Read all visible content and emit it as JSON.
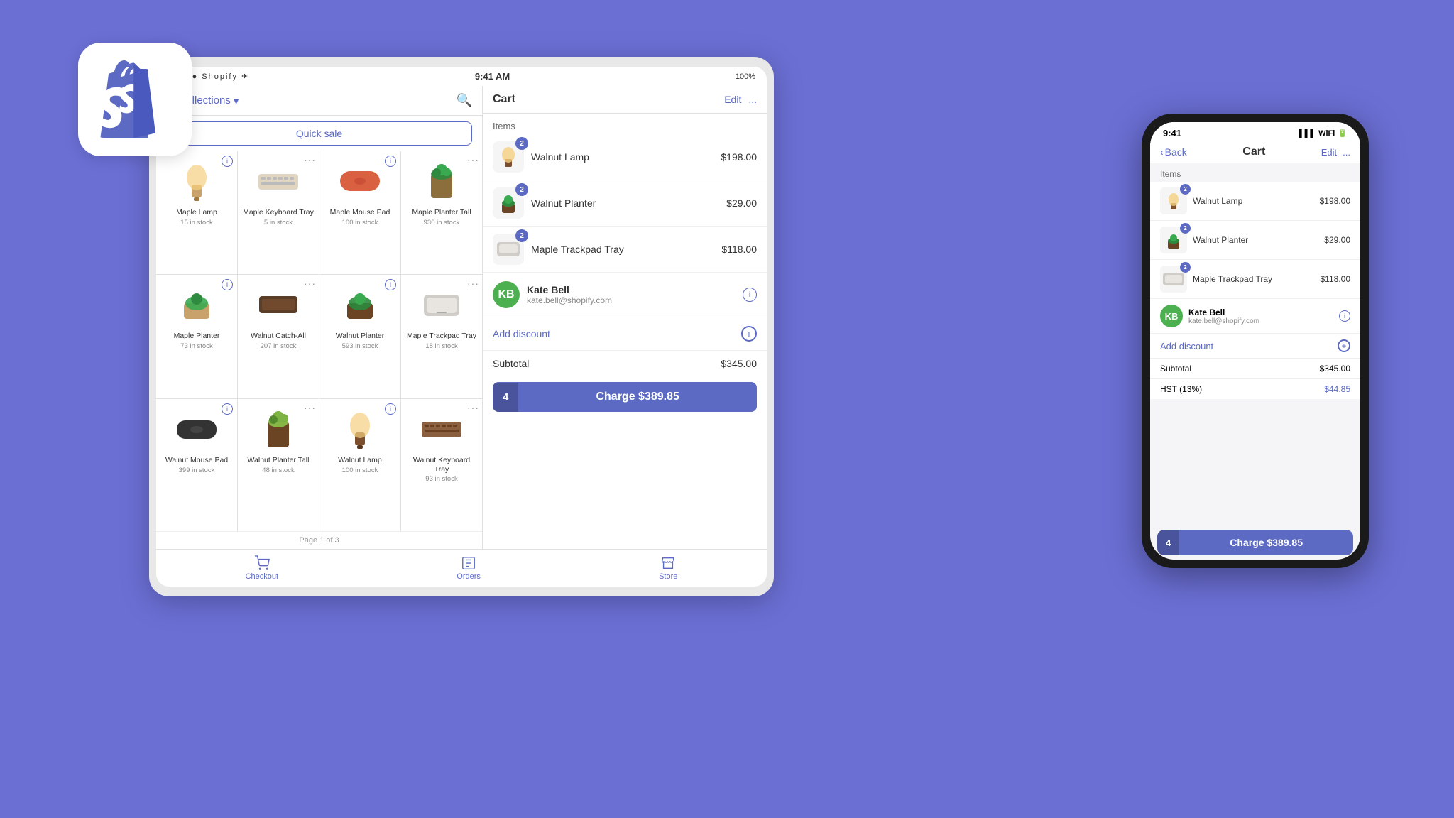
{
  "shopify_logo": {
    "alt": "Shopify Logo"
  },
  "tablet": {
    "status": {
      "signal": "•••••",
      "carrier": "Shopify",
      "wifi": "WiFi",
      "time": "9:41 AM",
      "battery": "100%"
    },
    "products_panel": {
      "collections_label": "All collections",
      "quick_sale_label": "Quick sale",
      "page_indicator": "Page 1 of 3",
      "products": [
        {
          "name": "Maple Lamp",
          "stock": "15 in stock",
          "type": "lamp"
        },
        {
          "name": "Maple Keyboard Tray",
          "stock": "5 in stock",
          "type": "keyboard"
        },
        {
          "name": "Maple Mouse Pad",
          "stock": "100 in stock",
          "type": "mousepad"
        },
        {
          "name": "Maple Planter Tall",
          "stock": "930 in stock",
          "type": "planter_tall"
        },
        {
          "name": "Maple Planter",
          "stock": "73 in stock",
          "type": "planter"
        },
        {
          "name": "Walnut Catch-All",
          "stock": "207 in stock",
          "type": "catch_all"
        },
        {
          "name": "Walnut Planter",
          "stock": "593 in stock",
          "type": "planter_walnut"
        },
        {
          "name": "Maple Trackpad Tray",
          "stock": "18 in stock",
          "type": "trackpad"
        },
        {
          "name": "Walnut Mouse Pad",
          "stock": "399 in stock",
          "type": "mousepad_walnut"
        },
        {
          "name": "Walnut Planter Tall",
          "stock": "48 in stock",
          "type": "planter_tall_walnut"
        },
        {
          "name": "Walnut Lamp",
          "stock": "100 in stock",
          "type": "lamp_walnut"
        },
        {
          "name": "Walnut Keyboard Tray",
          "stock": "93 in stock",
          "type": "keyboard_walnut"
        }
      ]
    },
    "cart": {
      "title": "Cart",
      "edit_label": "Edit",
      "more_label": "...",
      "items_label": "Items",
      "items": [
        {
          "name": "Walnut Lamp",
          "price": "$198.00",
          "qty": 2
        },
        {
          "name": "Walnut Planter",
          "price": "$29.00",
          "qty": 2
        },
        {
          "name": "Maple Trackpad Tray",
          "price": "$118.00",
          "qty": 2
        }
      ],
      "customer": {
        "name": "Kate Bell",
        "email": "kate.bell@shopify.com",
        "initials": "KB"
      },
      "add_discount_label": "Add discount",
      "subtotal_label": "Subtotal",
      "subtotal_value": "$345.00",
      "charge_qty": "4",
      "charge_label": "Charge $389.85"
    },
    "nav": {
      "checkout_label": "Checkout",
      "orders_label": "Orders",
      "store_label": "Store"
    }
  },
  "iphone": {
    "status": {
      "time": "9:41",
      "icons": "▌▌ WiFi ●"
    },
    "nav": {
      "back_label": "Back",
      "title": "Cart",
      "edit_label": "Edit",
      "more_label": "..."
    },
    "cart": {
      "items_label": "Items",
      "items": [
        {
          "name": "Walnut Lamp",
          "price": "$198.00",
          "qty": 2
        },
        {
          "name": "Walnut Planter",
          "price": "$29.00",
          "qty": 2
        },
        {
          "name": "Maple Trackpad Tray",
          "price": "$118.00",
          "qty": 2
        }
      ],
      "customer": {
        "name": "Kate Bell",
        "email": "kate.bell@shopify.com",
        "initials": "KB"
      },
      "add_discount_label": "Add discount",
      "subtotal_label": "Subtotal",
      "subtotal_value": "$345.00",
      "hst_label": "HST (13%)",
      "hst_value": "$44.85",
      "charge_qty": "4",
      "charge_label": "Charge $389.85"
    }
  },
  "background_color": "#6B6FD4",
  "accent_color": "#5C6AC4"
}
